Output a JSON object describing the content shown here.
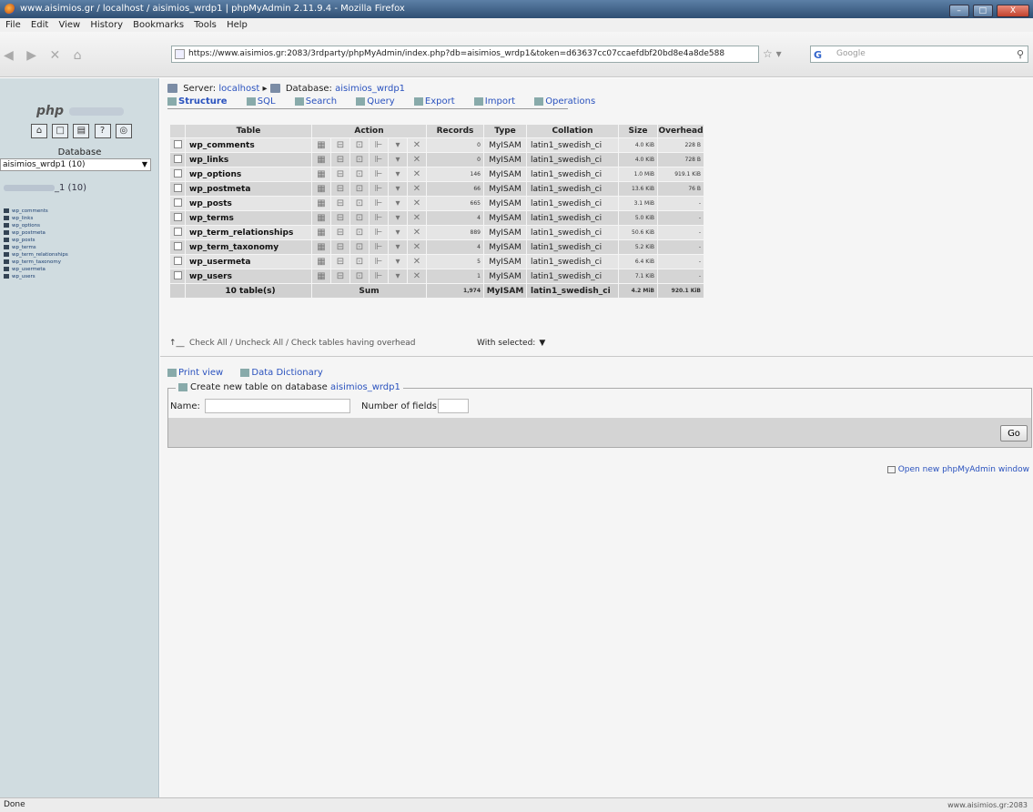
{
  "window": {
    "title": "www.aisimios.gr / localhost / aisimios_wrdp1 | phpMyAdmin 2.11.9.4 - Mozilla Firefox",
    "controls": [
      "–",
      "□",
      "X"
    ]
  },
  "menu": [
    "File",
    "Edit",
    "View",
    "History",
    "Bookmarks",
    "Tools",
    "Help"
  ],
  "nav": {
    "url": "https://www.aisimios.gr:2083/3rdparty/phpMyAdmin/index.php?db=aisimios_wrdp1&token=d63637cc07ccaefdbf20bd8e4a8de588",
    "search_placeholder": "Google",
    "search_engine_icon": "G"
  },
  "left": {
    "logo": "php",
    "db_label": "Database",
    "db_select": "aisimios_wrdp1 (10)",
    "db_heading_suffix": "_1 (10)",
    "tables": [
      "wp_comments",
      "wp_links",
      "wp_options",
      "wp_postmeta",
      "wp_posts",
      "wp_terms",
      "wp_term_relationships",
      "wp_term_taxonomy",
      "wp_usermeta",
      "wp_users"
    ]
  },
  "breadcrumb": {
    "server_label": "Server:",
    "server": "localhost",
    "db_label": "Database:",
    "db": "aisimios_wrdp1"
  },
  "tabs": [
    "Structure",
    "SQL",
    "Search",
    "Query",
    "Export",
    "Import",
    "Operations"
  ],
  "table": {
    "headers": {
      "table": "Table",
      "action": "Action",
      "records": "Records",
      "type": "Type",
      "collation": "Collation",
      "size": "Size",
      "overhead": "Overhead"
    },
    "rows": [
      {
        "name": "wp_comments",
        "records": "0",
        "type": "MyISAM",
        "collation": "latin1_swedish_ci",
        "size": "4.0 KiB",
        "overhead": "228 B"
      },
      {
        "name": "wp_links",
        "records": "0",
        "type": "MyISAM",
        "collation": "latin1_swedish_ci",
        "size": "4.0 KiB",
        "overhead": "728 B"
      },
      {
        "name": "wp_options",
        "records": "146",
        "type": "MyISAM",
        "collation": "latin1_swedish_ci",
        "size": "1.0 MiB",
        "overhead": "919.1 KiB"
      },
      {
        "name": "wp_postmeta",
        "records": "66",
        "type": "MyISAM",
        "collation": "latin1_swedish_ci",
        "size": "13.6 KiB",
        "overhead": "76 B"
      },
      {
        "name": "wp_posts",
        "records": "665",
        "type": "MyISAM",
        "collation": "latin1_swedish_ci",
        "size": "3.1 MiB",
        "overhead": "-"
      },
      {
        "name": "wp_terms",
        "records": "4",
        "type": "MyISAM",
        "collation": "latin1_swedish_ci",
        "size": "5.0 KiB",
        "overhead": "-"
      },
      {
        "name": "wp_term_relationships",
        "records": "889",
        "type": "MyISAM",
        "collation": "latin1_swedish_ci",
        "size": "50.6 KiB",
        "overhead": "-"
      },
      {
        "name": "wp_term_taxonomy",
        "records": "4",
        "type": "MyISAM",
        "collation": "latin1_swedish_ci",
        "size": "5.2 KiB",
        "overhead": "-"
      },
      {
        "name": "wp_usermeta",
        "records": "5",
        "type": "MyISAM",
        "collation": "latin1_swedish_ci",
        "size": "6.4 KiB",
        "overhead": "-"
      },
      {
        "name": "wp_users",
        "records": "1",
        "type": "MyISAM",
        "collation": "latin1_swedish_ci",
        "size": "7.1 KiB",
        "overhead": "-"
      }
    ],
    "sum": {
      "name": "10 table(s)",
      "label": "Sum",
      "records": "1,974",
      "type": "MyISAM",
      "collation": "latin1_swedish_ci",
      "size": "4.2 MiB",
      "overhead": "920.1 KiB"
    }
  },
  "bulk": {
    "check_all": "Check All / Uncheck All / Check tables having overhead",
    "with_selected": "With selected:"
  },
  "links": {
    "print_view": "Print view",
    "data_dictionary": "Data Dictionary"
  },
  "create": {
    "legend_prefix": "Create new table on database",
    "db": "aisimios_wrdp1",
    "name_label": "Name:",
    "fields_label": "Number of fields:",
    "go": "Go"
  },
  "open_window": "Open new phpMyAdmin window",
  "status": {
    "left": "Done",
    "right": "www.aisimios.gr:2083"
  }
}
